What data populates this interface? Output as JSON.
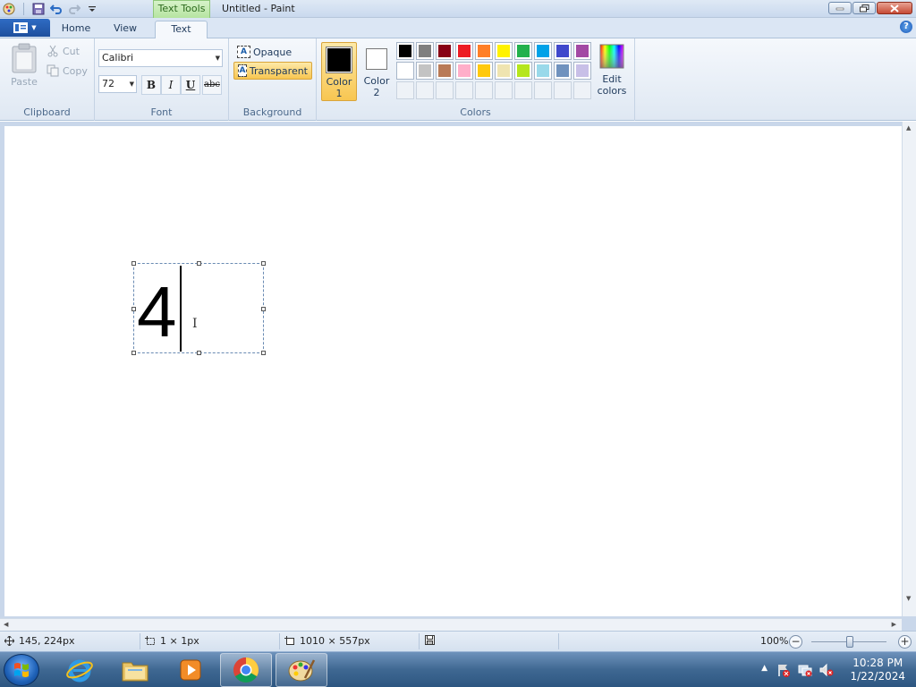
{
  "titlebar": {
    "contextual_tab": "Text Tools",
    "window_title": "Untitled - Paint"
  },
  "tabs": [
    {
      "label": "Home"
    },
    {
      "label": "View"
    },
    {
      "label": "Text"
    }
  ],
  "clipboard": {
    "paste_label": "Paste",
    "cut_label": "Cut",
    "copy_label": "Copy",
    "group_label": "Clipboard"
  },
  "font": {
    "family": "Calibri",
    "size": "72",
    "bold_label": "B",
    "italic_label": "I",
    "underline_label": "U",
    "strike_label": "abc",
    "group_label": "Font"
  },
  "background": {
    "opaque_label": "Opaque",
    "transparent_label": "Transparent",
    "selected": "Transparent",
    "group_label": "Background"
  },
  "colors": {
    "color1_label": "Color\n1",
    "color1_line1": "Color",
    "color1_line2": "1",
    "color2_line1": "Color",
    "color2_line2": "2",
    "color1": "#000000",
    "color2": "#ffffff",
    "edit_line1": "Edit",
    "edit_line2": "colors",
    "group_label": "Colors",
    "palette": [
      "#000000",
      "#7f7f7f",
      "#880015",
      "#ed1c24",
      "#ff7f27",
      "#fff200",
      "#22b14c",
      "#00a2e8",
      "#3f48cc",
      "#a349a4",
      "#ffffff",
      "#c3c3c3",
      "#b97a57",
      "#ffaec9",
      "#ffc90e",
      "#efe4b0",
      "#b5e61d",
      "#99d9ea",
      "#7092be",
      "#c8bfe7",
      "",
      "",
      "",
      "",
      "",
      "",
      "",
      "",
      "",
      ""
    ]
  },
  "canvas": {
    "text_content": "4"
  },
  "status": {
    "cursor_pos": "145, 224px",
    "selection_size": "1 × 1px",
    "canvas_size": "1010 × 557px",
    "zoom": "100%"
  },
  "taskbar": {
    "time": "10:28 PM",
    "date": "1/22/2024"
  }
}
